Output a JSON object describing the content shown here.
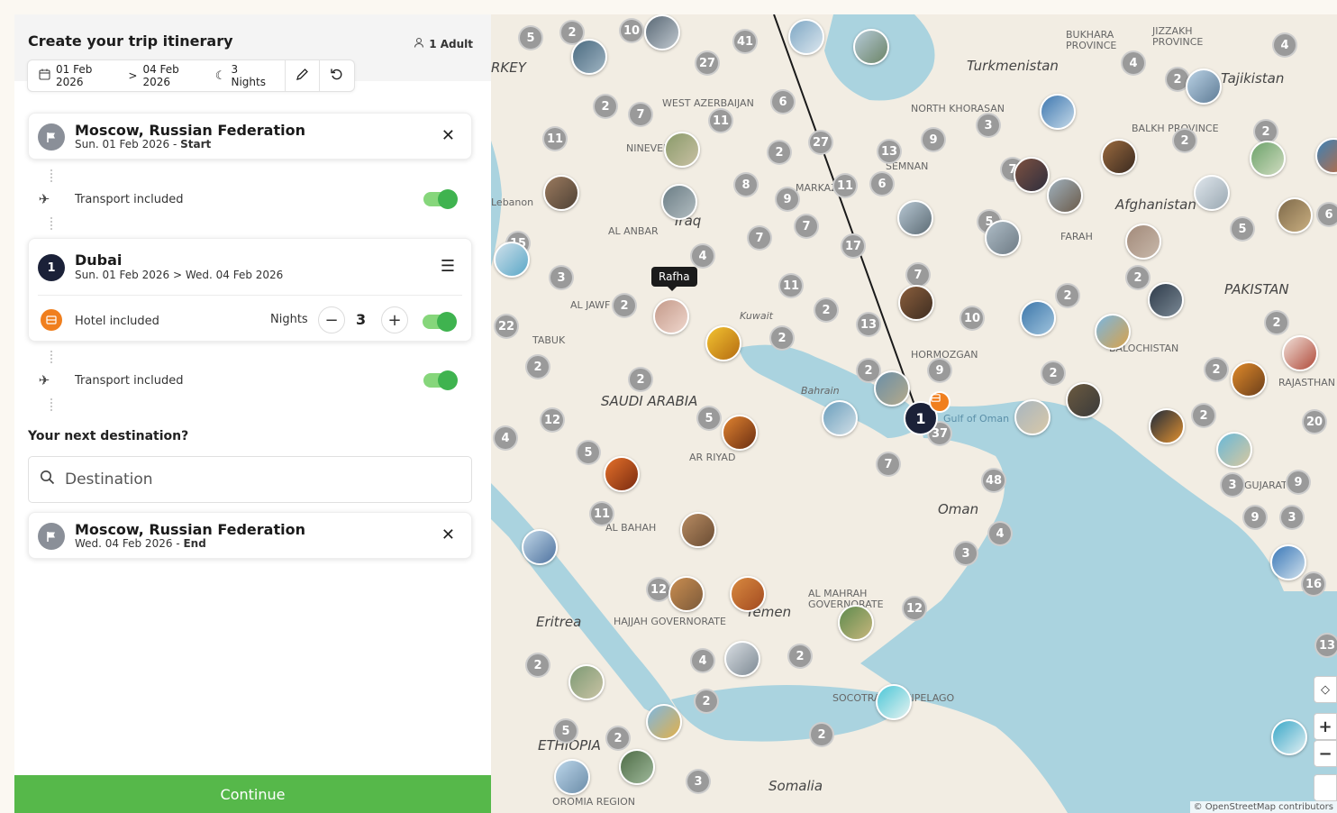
{
  "header": {
    "title": "Create your trip itinerary",
    "travelers": "1 Adult",
    "start_date": "01 Feb 2026",
    "arrow": ">",
    "end_date": "04 Feb 2026",
    "nights_label": "3 Nights"
  },
  "origin": {
    "city": "Moscow, Russian Federation",
    "date": "Sun. 01 Feb 2026",
    "sep": "-",
    "tag": "Start"
  },
  "transport_1": {
    "label": "Transport included",
    "enabled": true
  },
  "stop": {
    "number": "1",
    "city": "Dubai",
    "dates": "Sun. 01 Feb 2026 > Wed. 04 Feb 2026",
    "hotel_label": "Hotel included",
    "nights_label": "Nights",
    "nights": "3",
    "minus": "−",
    "plus": "+"
  },
  "transport_2": {
    "label": "Transport included",
    "enabled": true
  },
  "next": {
    "title": "Your next destination?",
    "placeholder": "Destination"
  },
  "destination_end": {
    "city": "Moscow, Russian Federation",
    "date": "Wed. 04 Feb 2026",
    "sep": "-",
    "tag": "End"
  },
  "continue_label": "Continue",
  "map": {
    "tooltip": "Rafha",
    "main_pin": "1",
    "labels": {
      "turkmenistan": "Turkmenistan",
      "tajikistan": "Tajikistan",
      "afghanistan": "Afghanistan",
      "pakistan": "PAKISTAN",
      "saudi": "SAUDI ARABIA",
      "oman": "Oman",
      "yemen": "Yemen",
      "eritrea": "Eritrea",
      "ethiopia": "ETHIOPIA",
      "somalia": "Somalia",
      "iraq": "Iraq",
      "kuwait": "Kuwait",
      "bahrain": "Bahrain",
      "gulf": "Gulf of Oman",
      "lebanon": "Lebanon",
      "rkey": "RKEY",
      "riyadh": "AR RIYAD",
      "tabuk": "TABUK",
      "aljawf": "AL JAWF",
      "alanbar": "AL ANBAR",
      "baha": "AL BAHAH",
      "mahrah": "AL MAHRAH GOVERNORATE",
      "hajjah": "HAJJAH GOVERNORATE",
      "socotra": "SOCOTRA ARCHIPELAGO",
      "hormozgan": "HORMOZGAN",
      "balochistan": "BALOCHISTAN",
      "rajasthan": "RAJASTHAN",
      "gujarat": "GUJARAT",
      "oromia": "OROMIA REGION",
      "bukhara": "BUKHARA PROVINCE",
      "jizzakh": "JIZZAKH PROVINCE",
      "khorasan": "NORTH KHORASAN",
      "balkh": "BALKH PROVINCE",
      "farah": "FARAH",
      "semnan": "SEMNAN",
      "markazi": "MARKAZI",
      "nineveh": "NINEVEH",
      "wazarbaijan": "WEST AZERBAIJAN"
    },
    "attribution": "© OpenStreetMap contributors"
  },
  "colors": {
    "accent_green": "#56b84a",
    "toggle_green": "#3fb34f",
    "hotel_orange": "#f07f1e",
    "navy": "#1b2138",
    "water": "#aad3df",
    "land": "#f2ede3"
  }
}
